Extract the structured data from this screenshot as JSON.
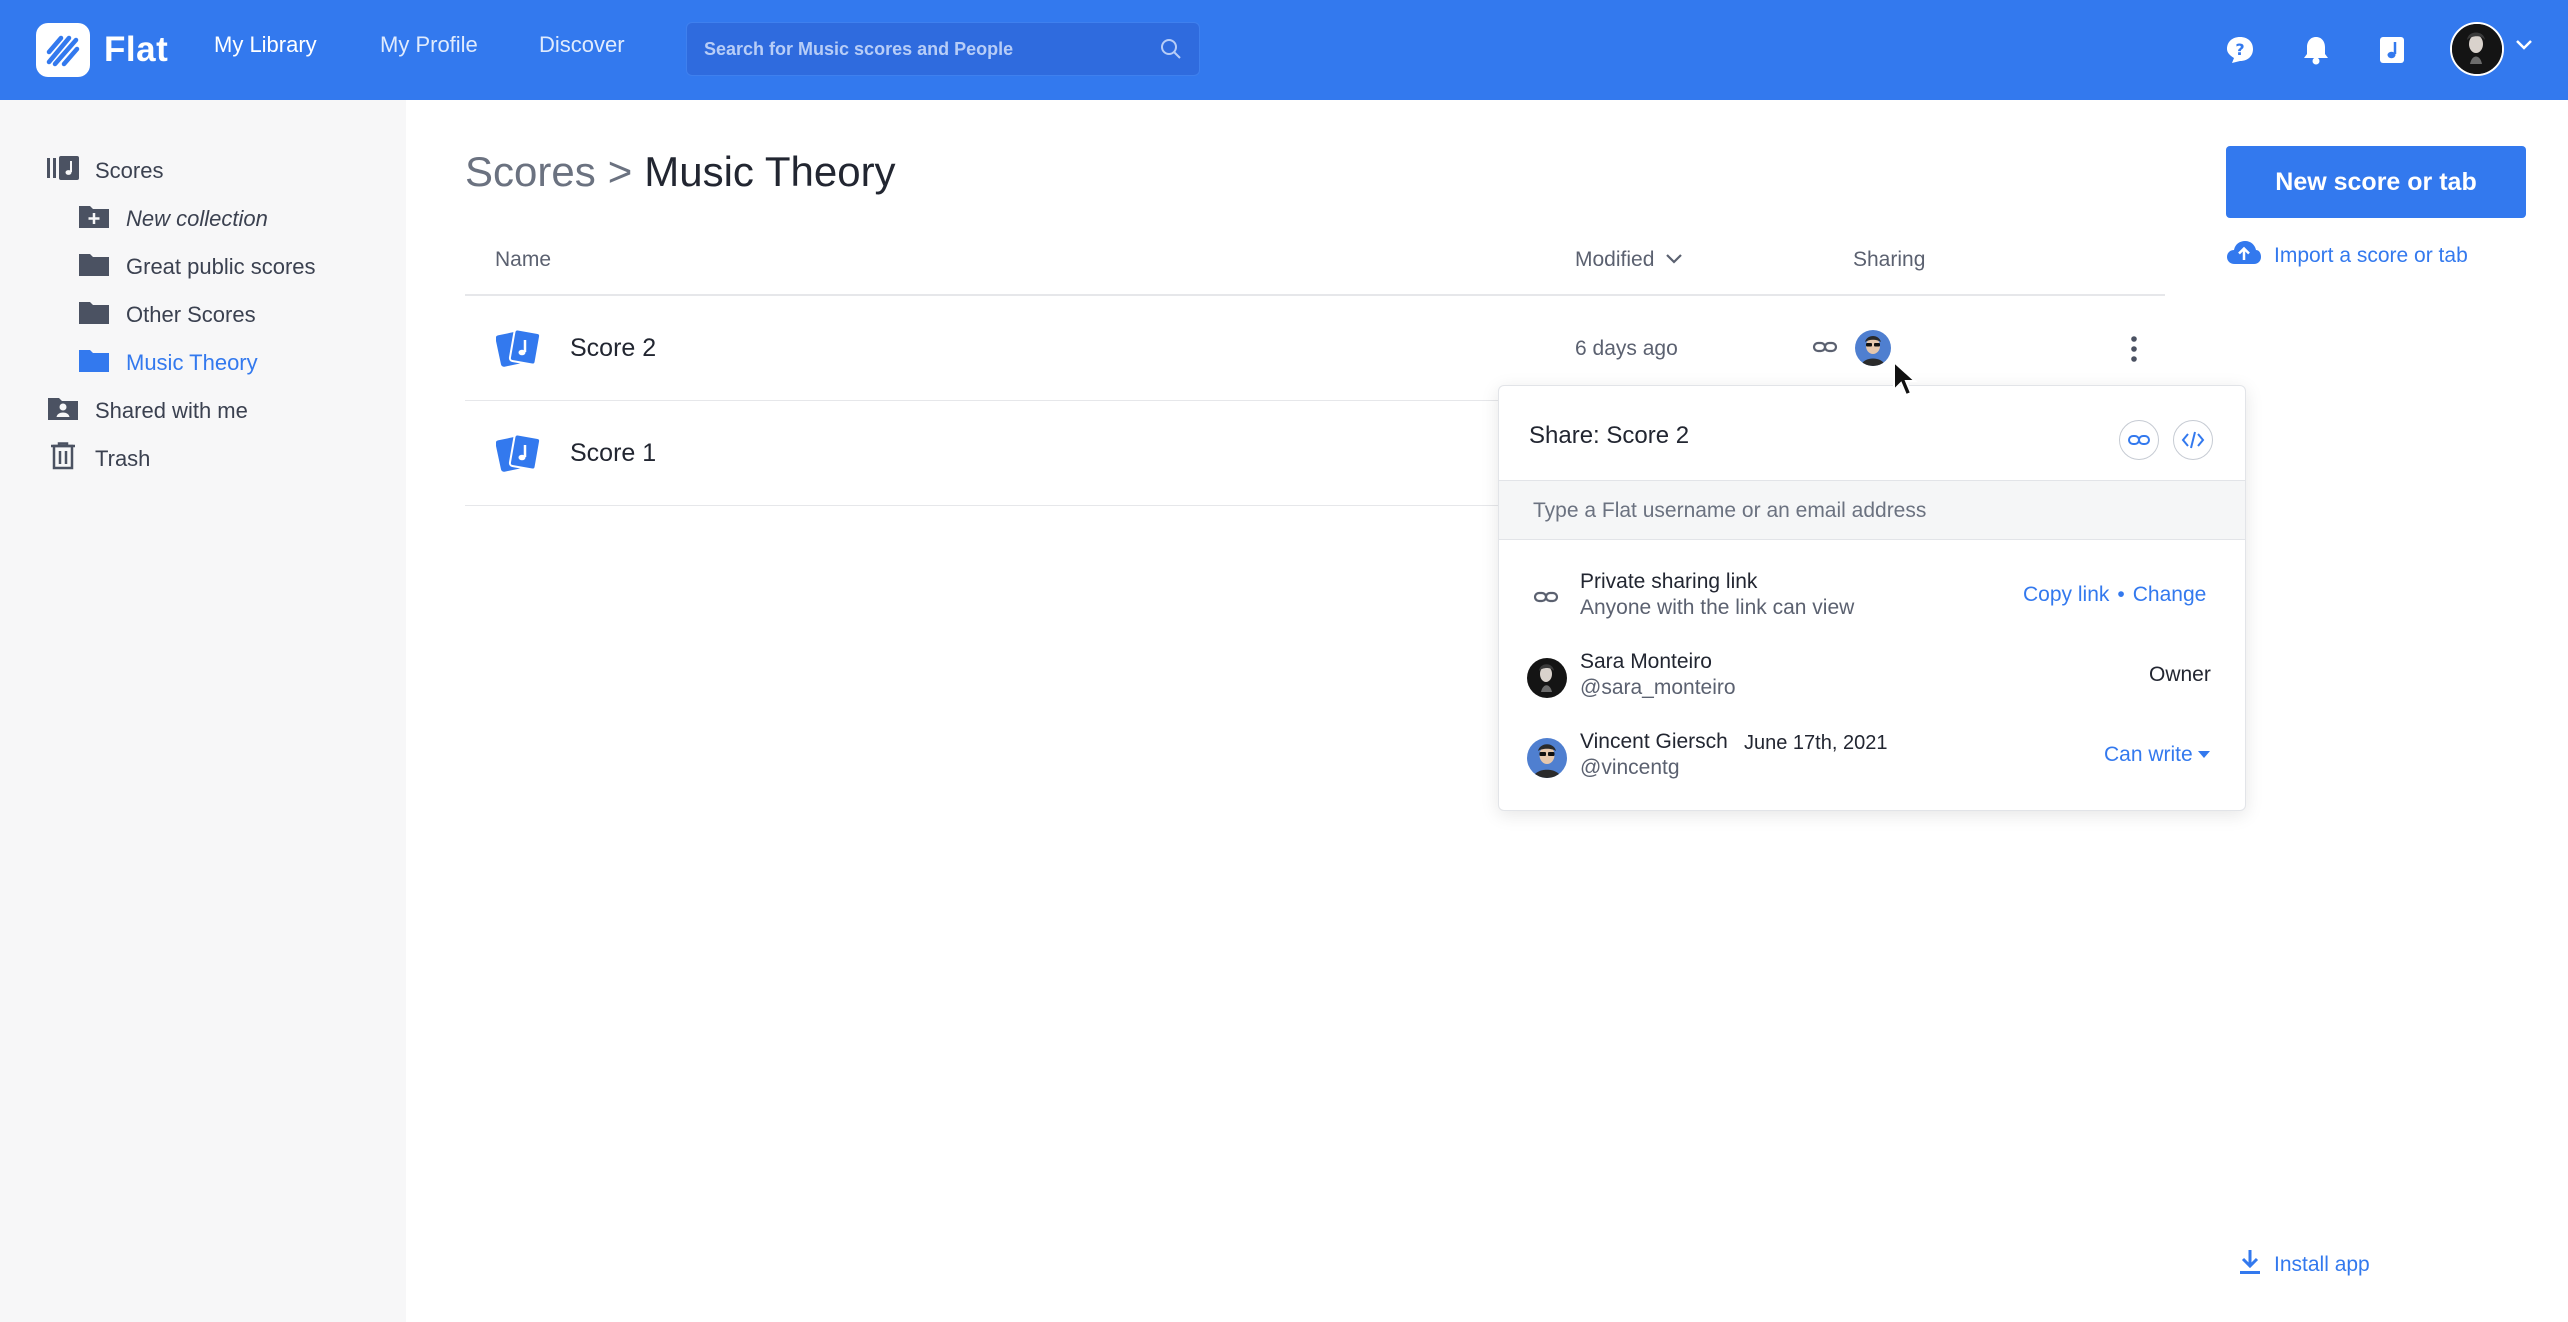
{
  "topbar": {
    "logo_text": "Flat",
    "nav": [
      "My Library",
      "My Profile",
      "Discover"
    ],
    "search_placeholder": "Search for Music scores and People",
    "accent": "#3379ee"
  },
  "sidebar": {
    "items": [
      {
        "label": "Scores",
        "icon": "scores-icon"
      },
      {
        "label": "New collection",
        "icon": "folder-plus-icon"
      },
      {
        "label": "Great public scores",
        "icon": "folder-icon"
      },
      {
        "label": "Other Scores",
        "icon": "folder-icon"
      },
      {
        "label": "Music Theory",
        "icon": "folder-icon"
      },
      {
        "label": "Shared with me",
        "icon": "shared-folder-icon"
      },
      {
        "label": "Trash",
        "icon": "trash-icon"
      }
    ]
  },
  "main": {
    "breadcrumb_parent": "Scores",
    "breadcrumb_sep": ">",
    "breadcrumb_current": "Music Theory",
    "columns": {
      "name": "Name",
      "modified": "Modified",
      "sharing": "Sharing"
    },
    "rows": [
      {
        "name": "Score 2",
        "modified": "6 days ago"
      },
      {
        "name": "Score 1",
        "modified": ""
      }
    ],
    "new_score_label": "New score or tab",
    "import_label": "Import a score or tab",
    "install_label": "Install app"
  },
  "share_popover": {
    "title": "Share: Score 2",
    "input_placeholder": "Type a Flat username or an email address",
    "private_link_title": "Private sharing link",
    "private_link_sub": "Anyone with the link can view",
    "copy_link": "Copy link",
    "bullet": "•",
    "change": "Change",
    "users": [
      {
        "name": "Sara Monteiro",
        "handle": "@sara_monteiro",
        "date": "",
        "role": "Owner"
      },
      {
        "name": "Vincent Giersch",
        "handle": "@vincentg",
        "date": "June 17th, 2021",
        "role": "Can write"
      }
    ]
  }
}
